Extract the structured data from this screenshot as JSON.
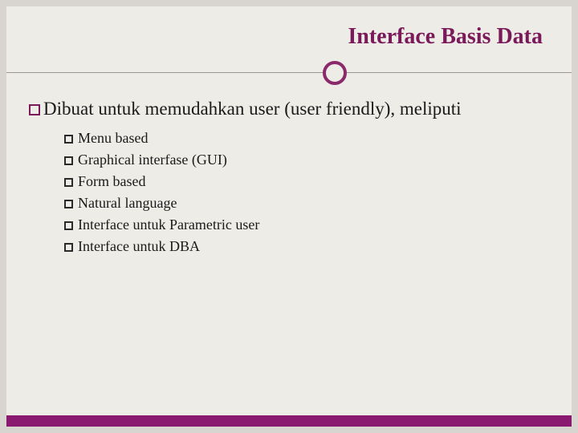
{
  "title": "Interface Basis Data",
  "main": {
    "text": "Dibuat untuk memudahkan user (user friendly), meliputi"
  },
  "sub_items": [
    "Menu based",
    "Graphical interfase (GUI)",
    "Form based",
    "Natural language",
    "Interface untuk Parametric user",
    "Interface untuk DBA"
  ],
  "colors": {
    "accent": "#7a1a5a",
    "footer": "#8a1a6f",
    "bg": "#eeece7"
  }
}
